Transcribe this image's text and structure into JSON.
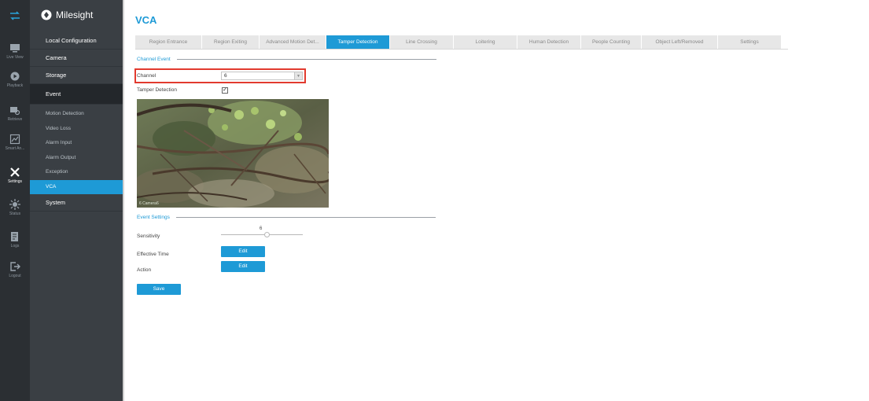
{
  "rail": {
    "items": [
      {
        "label": "Live View",
        "icon": "monitor-icon"
      },
      {
        "label": "Playback",
        "icon": "playback-icon"
      },
      {
        "label": "Retrieve",
        "icon": "retrieve-icon"
      },
      {
        "label": "Smart An...",
        "icon": "smart-analysis-icon"
      },
      {
        "label": "Settings",
        "icon": "settings-icon"
      },
      {
        "label": "Status",
        "icon": "status-icon"
      },
      {
        "label": "Logs",
        "icon": "logs-icon"
      },
      {
        "label": "Logout",
        "icon": "logout-icon"
      }
    ]
  },
  "brand": {
    "name": "Milesight"
  },
  "menu": {
    "local_configuration": "Local Configuration",
    "camera": "Camera",
    "storage": "Storage",
    "event": "Event",
    "system": "System",
    "event_sub": [
      "Motion Detection",
      "Video Loss",
      "Alarm Input",
      "Alarm Output",
      "Exception",
      "VCA"
    ]
  },
  "page": {
    "title": "VCA"
  },
  "tabs": [
    "Region Entrance",
    "Region Exiting",
    "Advanced Motion Det...",
    "Tamper Detection",
    "Line Crossing",
    "Loitering",
    "Human Detection",
    "People Counting",
    "Object Left/Removed",
    "Settings"
  ],
  "active_tab": "Tamper Detection",
  "channel_event": {
    "heading": "Channel Event",
    "channel_label": "Channel",
    "channel_value": "6",
    "tamper_label": "Tamper Detection",
    "tamper_checked": "✓"
  },
  "preview": {
    "overlay_text": "6  Camera6"
  },
  "event_settings": {
    "heading": "Event Settings",
    "sensitivity_label": "Sensitivity",
    "sensitivity_value": "6",
    "sensitivity_fraction": 0.56,
    "effective_time_label": "Effective Time",
    "action_label": "Action",
    "edit_label": "Edit"
  },
  "save_label": "Save",
  "colors": {
    "accent": "#1e9ad6",
    "highlight": "#e23a2e",
    "sidebar": "#3a3f44",
    "rail": "#2b2f33"
  }
}
